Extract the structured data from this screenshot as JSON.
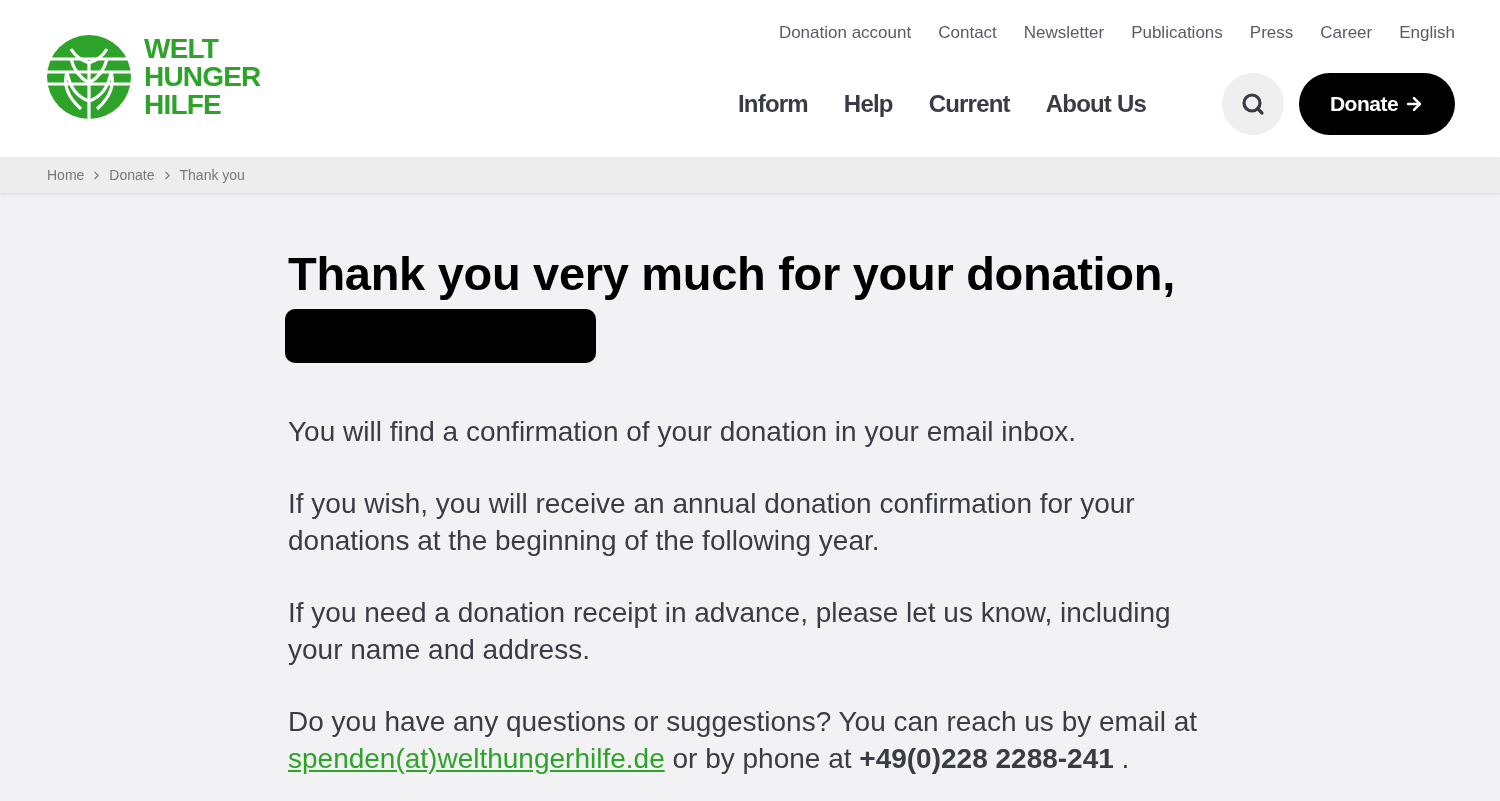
{
  "logo": {
    "lines": [
      "WELT",
      "HUNGER",
      "HILFE"
    ]
  },
  "top_links": [
    "Donation account",
    "Contact",
    "Newsletter",
    "Publications",
    "Press",
    "Career",
    "English"
  ],
  "main_nav": [
    "Inform",
    "Help",
    "Current",
    "About Us"
  ],
  "donate_button": {
    "label": "Donate"
  },
  "breadcrumbs": [
    "Home",
    "Donate",
    "Thank you"
  ],
  "heading": "Thank you very much for your donation,",
  "paragraphs": [
    "You will find a confirmation of your donation in your email inbox.",
    "If you wish, you will receive an annual donation confirmation for your donations at the beginning of the following year.",
    "If you need a donation receipt in advance, please let us know, including your name and address."
  ],
  "contact": {
    "before": "Do you have any questions or suggestions? You can reach us by email at",
    "email": "spenden(at)welthungerhilfe.de",
    "after": "or by phone at **+49(0)228 2288-241** ."
  }
}
